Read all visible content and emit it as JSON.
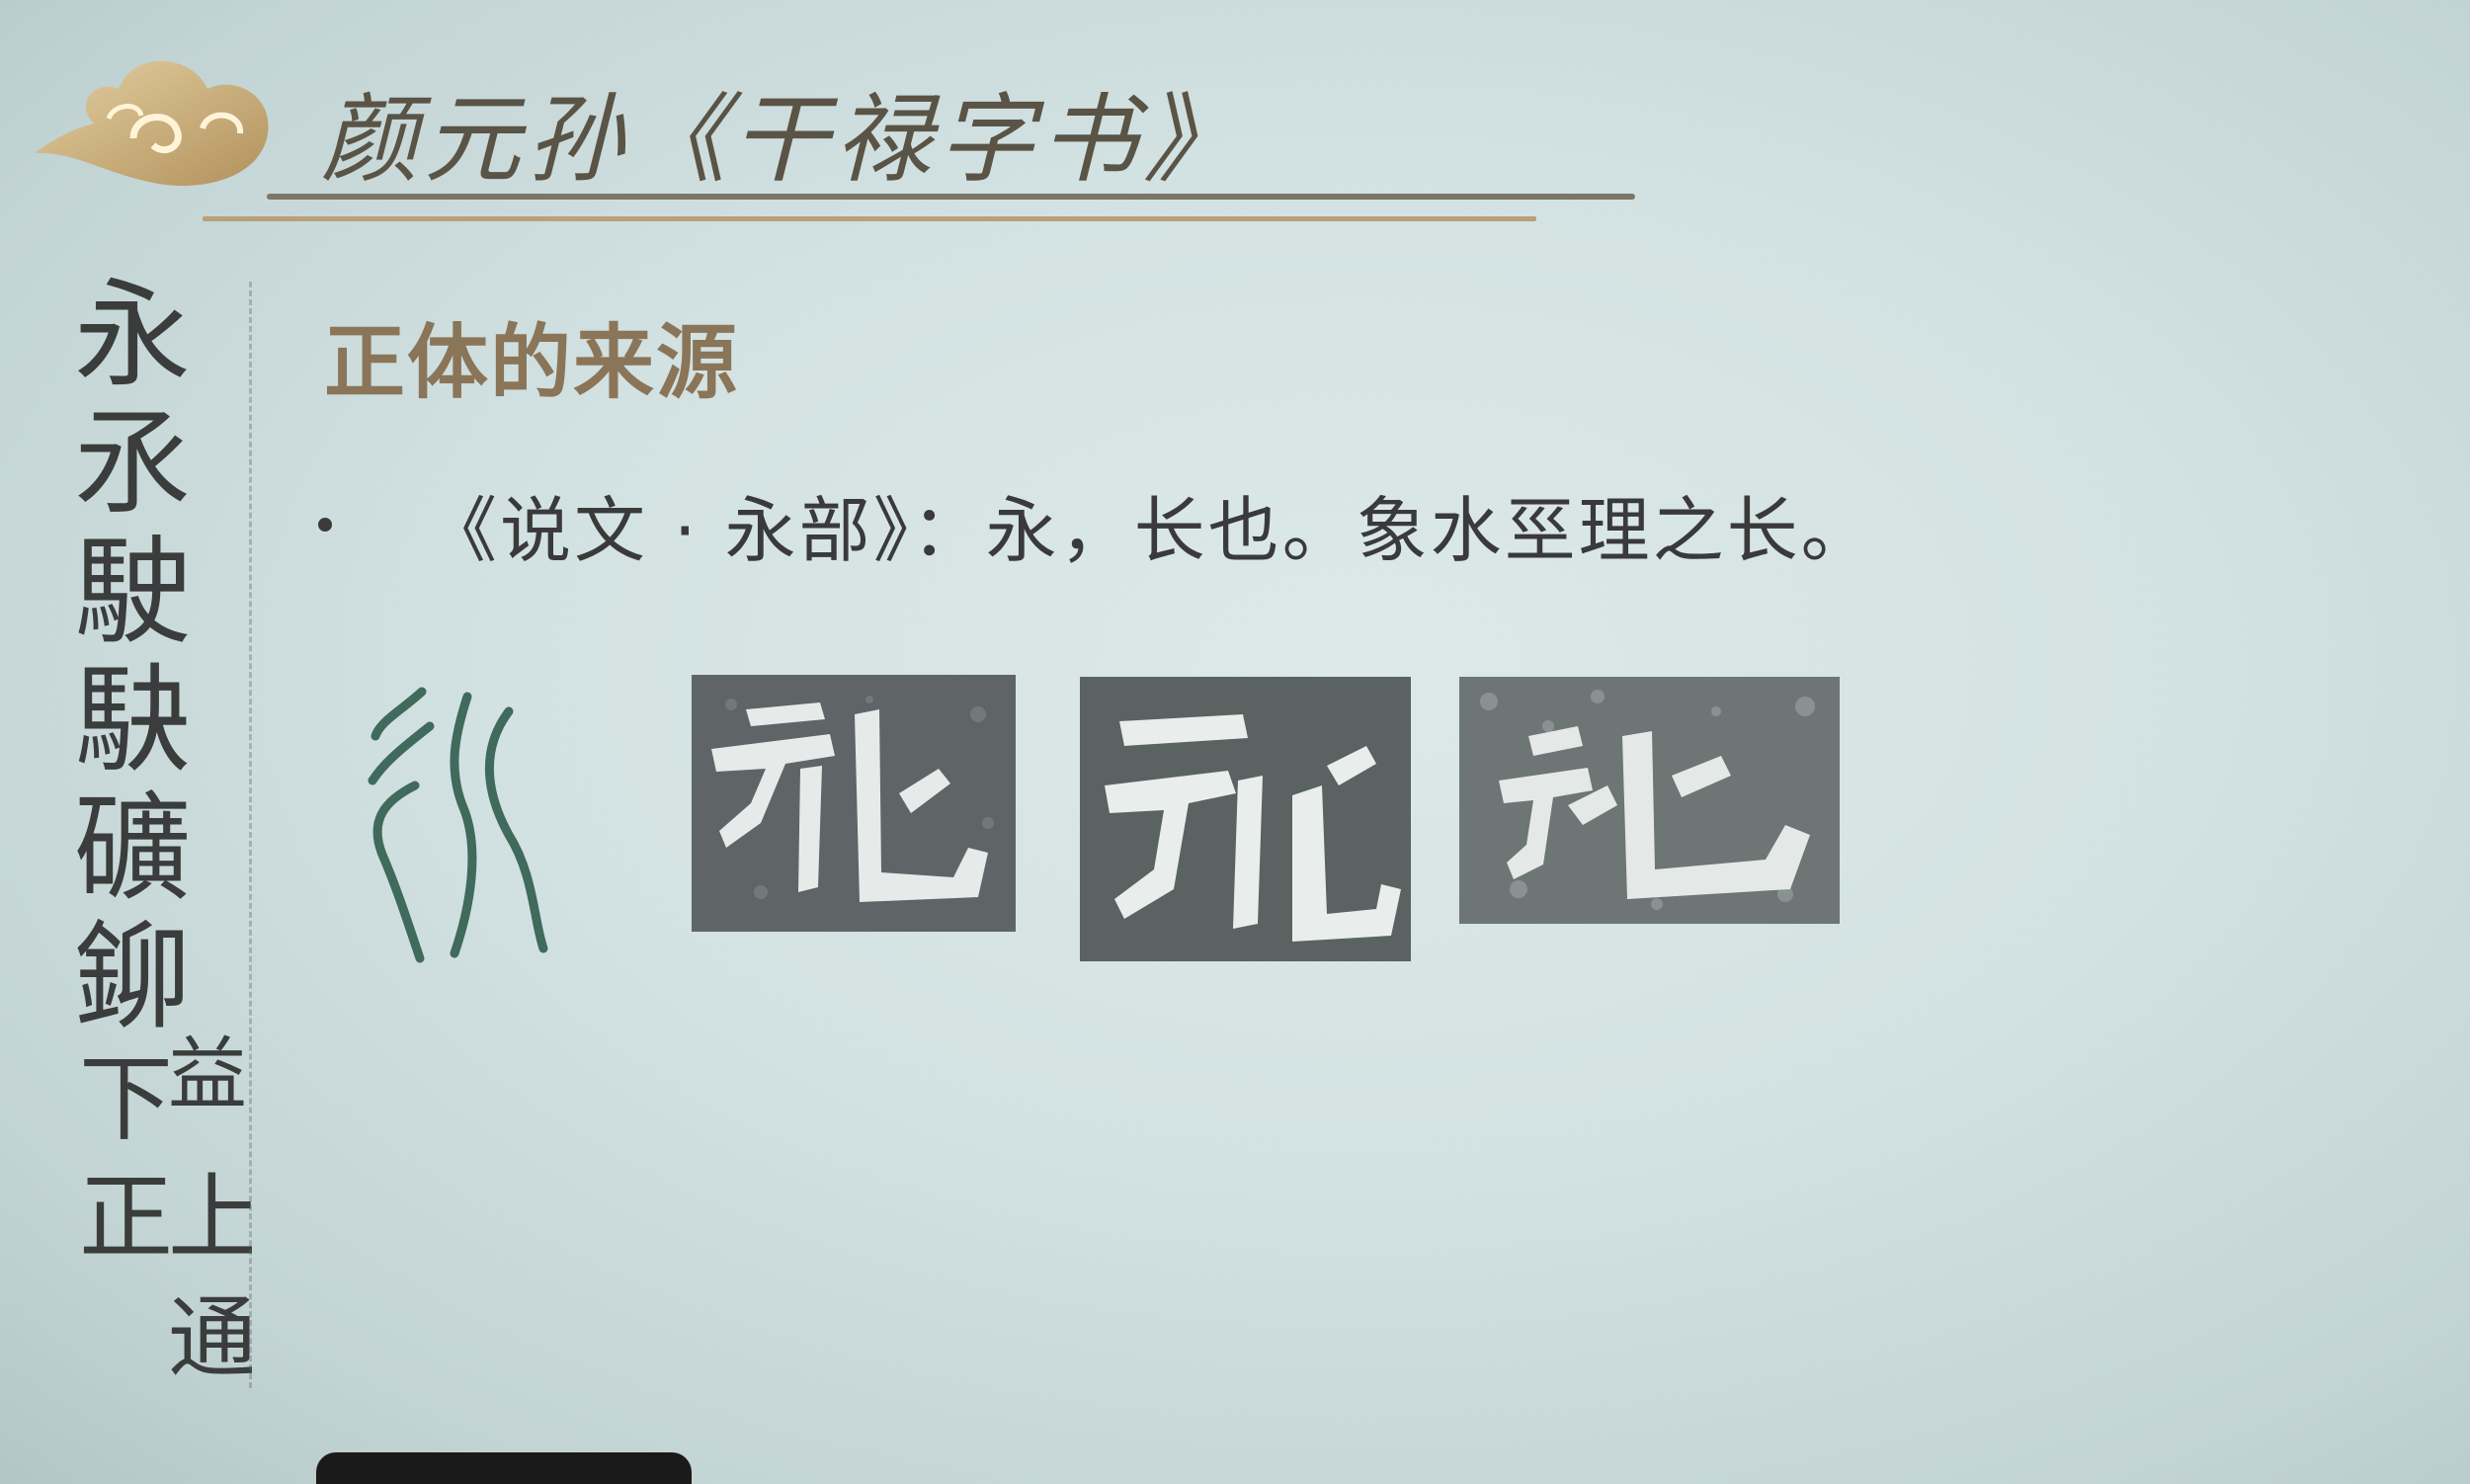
{
  "slide": {
    "title": "颜元孙《干禄字书》",
    "section_heading": "正体的来源",
    "bullet_text": "《说文 · 永部》：永，长也。象水巠理之长。"
  },
  "calligraphy_column": {
    "characters": [
      "永",
      "氶",
      "駛",
      "駃",
      "礦",
      "鉚",
      "下",
      "正",
      "益",
      "上",
      "通"
    ]
  },
  "icons": {
    "logo": "auspicious-cloud-icon"
  },
  "colors": {
    "background": "#d2e1e1",
    "title_text": "#5a5446",
    "heading_text": "#8a7558",
    "body_text": "#3a3a3a",
    "rule_dark": "#7b7666",
    "rule_gold": "#b9a07a",
    "seal_ink": "#3f6a5c",
    "rubbing_bg": "#5f6566",
    "rubbing_ink": "#e8ecea"
  }
}
